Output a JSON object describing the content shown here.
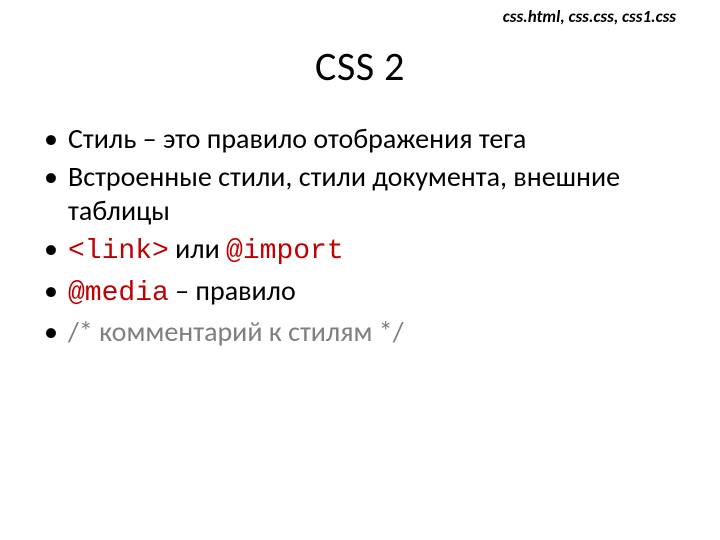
{
  "topnote": "css.html, css.css, css1.css",
  "title": "CSS 2",
  "bullets": {
    "b1": "Стиль – это правило отображения тега",
    "b2": "Встроенные стили, стили документа, внешние таблицы",
    "b3_code1": "<link>",
    "b3_mid": " или ",
    "b3_code2": "@import",
    "b4_code": "@media",
    "b4_rest": " – правило",
    "b5": "/* комментарий к стилям */"
  }
}
